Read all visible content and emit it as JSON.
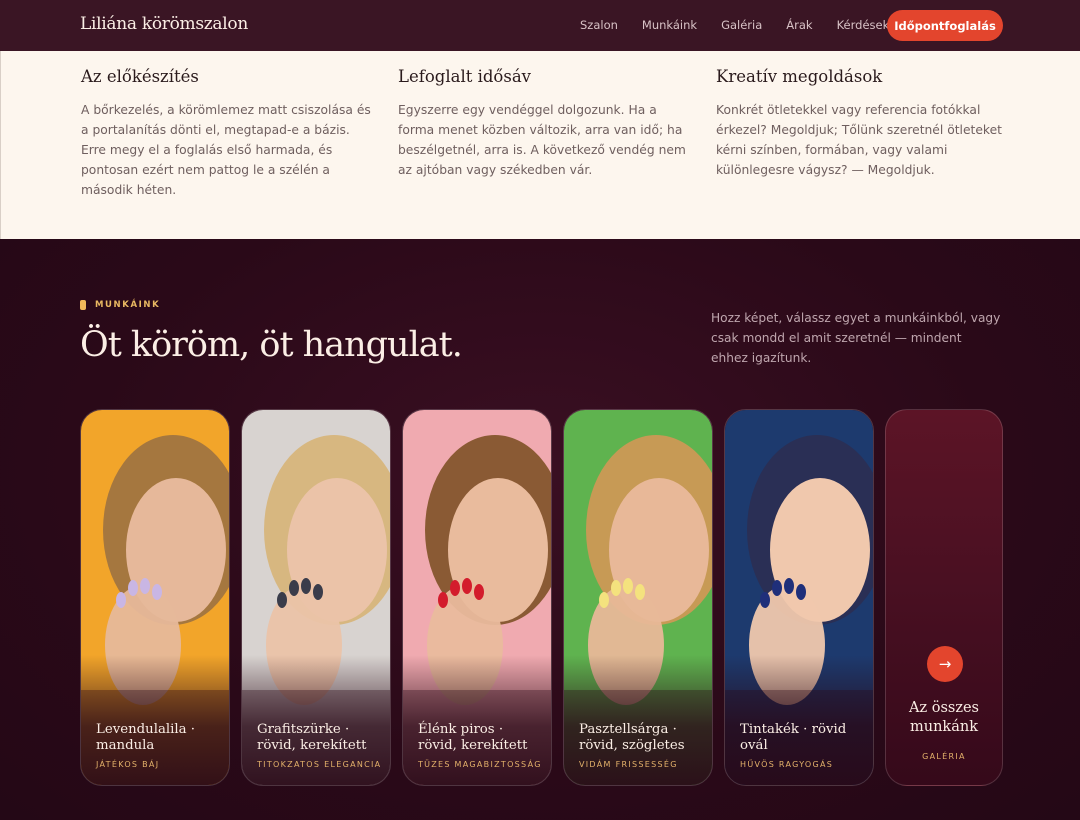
{
  "header": {
    "brand": "Liliána körömszalon",
    "nav": [
      "Szalon",
      "Munkáink",
      "Galéria",
      "Árak",
      "Kérdések"
    ],
    "cta": "Időpontfoglalás"
  },
  "features": [
    {
      "title": "Az előkészítés",
      "body": "A bőrkezelés, a körömlemez matt csiszolása és a portalanítás dönti el, megtapad-e a bázis. Erre megy el a foglalás első harmada, és pontosan ezért nem pattog le a szélén a második héten."
    },
    {
      "title": "Lefoglalt idősáv",
      "body": "Egyszerre egy vendéggel dolgozunk. Ha a forma menet közben változik, arra van idő; ha beszélgetnél, arra is. A következő vendég nem az ajtóban vagy székedben vár."
    },
    {
      "title": "Kreatív megoldások",
      "body": "Konkrét ötletekkel vagy referencia fotókkal érkezel? Megoldjuk; Tőlünk szeretnél ötleteket kérni színben, formában, vagy valami különlegesre vágysz? — Megoldjuk."
    }
  ],
  "works": {
    "eyebrow": "MUNKÁINK",
    "headline": "Öt köröm, öt hangulat.",
    "intro": "Hozz képet, válassz egyet a munkáinkból, vagy csak mondd el amit szeretnél — mindent ehhez igazítunk.",
    "cards": [
      {
        "title": "Levendulalila · mandula",
        "subtitle": "JÁTÉKOS BÁJ",
        "nail_color": "#c9b6e4",
        "bg": "#f2a52a",
        "skin": "#e6b89a",
        "hair": "#a5773f"
      },
      {
        "title": "Grafitszürke · rövid, kerekített",
        "subtitle": "TITOKZATOS ELEGANCIA",
        "nail_color": "#3a3c4a",
        "bg": "#d8d3d0",
        "skin": "#ebc3a8",
        "hair": "#d7b780"
      },
      {
        "title": "Élénk piros · rövid, kerekített",
        "subtitle": "TÜZES MAGABIZTOSSÁG",
        "nail_color": "#d31c2c",
        "bg": "#f0aab0",
        "skin": "#e9bb9d",
        "hair": "#8a5a34"
      },
      {
        "title": "Pasztellsárga · rövid, szögletes",
        "subtitle": "VIDÁM FRISSESSÉG",
        "nail_color": "#f4e27e",
        "bg": "#5fb34f",
        "skin": "#e8b898",
        "hair": "#c79a55"
      },
      {
        "title": "Tintakék · rövid ovál",
        "subtitle": "HŰVÖS RAGYOGÁS",
        "nail_color": "#1f2f7a",
        "bg": "#1d3a6e",
        "skin": "#f0c8ad",
        "hair": "#2a2f55"
      }
    ],
    "more": {
      "label": "Az összes munkánk",
      "subtitle": "GALÉRIA",
      "icon": "arrow-right-icon"
    }
  }
}
